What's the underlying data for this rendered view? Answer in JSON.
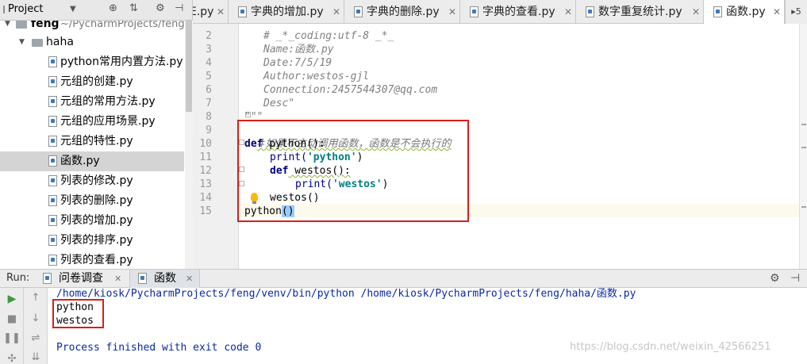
{
  "project_panel": {
    "title": "Project",
    "tree": [
      {
        "label": "feng",
        "path": "~/PycharmProjects/feng",
        "kind": "folder"
      },
      {
        "label": "haha",
        "kind": "folder"
      },
      {
        "label": "python常用内置方法.py",
        "kind": "file"
      },
      {
        "label": "元组的创建.py",
        "kind": "file"
      },
      {
        "label": "元组的常用方法.py",
        "kind": "file"
      },
      {
        "label": "元组的应用场景.py",
        "kind": "file"
      },
      {
        "label": "元组的特性.py",
        "kind": "file"
      },
      {
        "label": "函数.py",
        "kind": "file",
        "selected": true
      },
      {
        "label": "列表的修改.py",
        "kind": "file"
      },
      {
        "label": "列表的删除.py",
        "kind": "file"
      },
      {
        "label": "列表的增加.py",
        "kind": "file"
      },
      {
        "label": "列表的排序.py",
        "kind": "file"
      },
      {
        "label": "列表的查看.py",
        "kind": "file"
      }
    ]
  },
  "editor_tabs": [
    {
      "label": "E.py"
    },
    {
      "label": "字典的增加.py"
    },
    {
      "label": "字典的删除.py"
    },
    {
      "label": "字典的查看.py"
    },
    {
      "label": "数字重复统计.py"
    },
    {
      "label": "函数.py",
      "active": true
    }
  ],
  "tab_overflow": "▸5",
  "editor": {
    "line_numbers": [
      "2",
      "3",
      "4",
      "5",
      "6",
      "7",
      "8",
      "9",
      "10",
      "11",
      "12",
      "13",
      "14",
      "15"
    ],
    "doc_lines": [
      "# _*_coding:utf-8 _*_",
      "Name:函数.py",
      "Date:7/5/19",
      "Author:westos-gjl",
      "Connection:2457544307@qq.com",
      "Desc\"",
      "\"\"\""
    ],
    "comment": "#如果不主动调用函数，函数是不会执行的",
    "def_kw": "def",
    "python_def": " python():",
    "print_fn": "print(",
    "str_python": "'python'",
    "close_paren": ")",
    "westos_def": " westos():",
    "str_westos": "'westos'",
    "westos_call": "westos()",
    "python_call": "python",
    "call_parens": "()"
  },
  "run_panel": {
    "label": "Run:",
    "tabs": [
      {
        "label": "问卷调查"
      },
      {
        "label": "函数",
        "active": true
      }
    ],
    "console": {
      "command": "/home/kiosk/PycharmProjects/feng/venv/bin/python /home/kiosk/PycharmProjects/feng/haha/函数.py",
      "output": [
        "python",
        "westos"
      ],
      "exit": "Process finished with exit code 0"
    }
  },
  "watermark": "https://blog.csdn.net/weixin_42566251",
  "colors": {
    "highlight_box": "#d91e18",
    "keyword": "#000080",
    "string": "#008080",
    "console_blue": "#0a2aa0"
  }
}
